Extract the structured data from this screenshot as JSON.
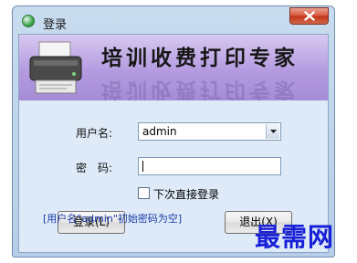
{
  "window": {
    "title": "登录"
  },
  "banner": {
    "title": "培训收费打印专家"
  },
  "form": {
    "username_label": "用户名:",
    "username_value": "admin",
    "password_label": "密　码:",
    "password_value": "",
    "remember_label": "下次直接登录",
    "remember_checked": false
  },
  "buttons": {
    "login": "登录(L)",
    "exit": "退出(X)"
  },
  "hint": "[用户名\"admin\"初始密码为空]",
  "watermark": "最需网",
  "icons": {
    "app": "app-icon",
    "close": "close-icon",
    "dropdown": "chevron-down-icon",
    "printer": "printer-icon"
  },
  "colors": {
    "banner": "#b49be0",
    "close_button": "#c84a30",
    "hint_text": "#1a3aa8",
    "watermark": "#1820d8"
  }
}
